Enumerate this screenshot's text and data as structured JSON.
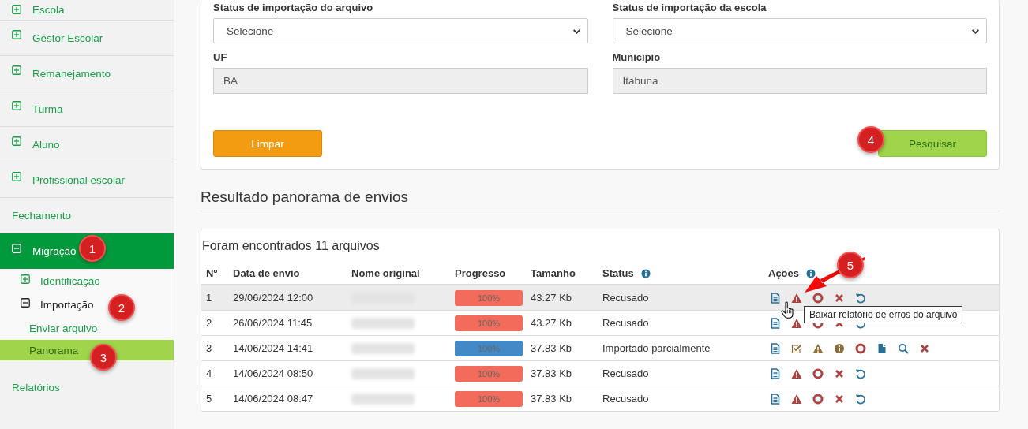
{
  "sidebar": {
    "items": [
      {
        "label": "Escola",
        "kind": "group",
        "expanded": false,
        "selected": false
      },
      {
        "label": "Gestor Escolar",
        "kind": "group",
        "expanded": false,
        "selected": false
      },
      {
        "label": "Remanejamento",
        "kind": "group",
        "expanded": false,
        "selected": false
      },
      {
        "label": "Turma",
        "kind": "group",
        "expanded": false,
        "selected": false
      },
      {
        "label": "Aluno",
        "kind": "group",
        "expanded": false,
        "selected": false
      },
      {
        "label": "Profissional escolar",
        "kind": "group",
        "expanded": false,
        "selected": false
      },
      {
        "label": "Fechamento",
        "kind": "link",
        "selected": false
      },
      {
        "label": "Migração",
        "kind": "group",
        "expanded": true,
        "selected": true,
        "children": [
          {
            "label": "Identificação",
            "kind": "group",
            "expanded": false,
            "selected": false
          },
          {
            "label": "Importação",
            "kind": "group",
            "expanded": true,
            "selected": false,
            "children": [
              {
                "label": "Enviar arquivo",
                "kind": "link",
                "selected": false
              },
              {
                "label": "Panorama",
                "kind": "link",
                "selected": true
              }
            ]
          }
        ]
      },
      {
        "label": "Relatórios",
        "kind": "link",
        "selected": false
      }
    ]
  },
  "filters": {
    "fields": [
      {
        "label": "Status de importação do arquivo",
        "kind": "select",
        "value": "Selecione"
      },
      {
        "label": "Status de importação da escola",
        "kind": "select",
        "value": "Selecione"
      },
      {
        "label": "UF",
        "kind": "readonly",
        "value": "BA"
      },
      {
        "label": "Município",
        "kind": "readonly",
        "value": "Itabuna"
      }
    ],
    "buttons": [
      {
        "label": "Limpar",
        "kind": "clear"
      },
      {
        "label": "Pesquisar",
        "kind": "search"
      }
    ]
  },
  "results": {
    "title": "Resultado panorama de envios",
    "summary": "Foram encontrados 11 arquivos",
    "columns": [
      {
        "label": "Nº"
      },
      {
        "label": "Data de envio"
      },
      {
        "label": "Nome original"
      },
      {
        "label": "Progresso"
      },
      {
        "label": "Tamanho"
      },
      {
        "label": "Status",
        "info": true
      },
      {
        "label": "Ações",
        "info": true
      }
    ],
    "rows": [
      {
        "no": "1",
        "date": "29/06/2024 12:00",
        "progress": {
          "level": 1,
          "label": "100%",
          "color": "#f26b5b"
        },
        "size": "43.27 Kb",
        "status": "Recusado",
        "highlighted": true,
        "actions": [
          {
            "kind": "document",
            "color": "#2b6f94"
          },
          {
            "kind": "warning",
            "color": "#a94442"
          },
          {
            "kind": "stop",
            "color": "#a94442"
          },
          {
            "kind": "remove",
            "color": "#a94442"
          },
          {
            "kind": "undo",
            "color": "#2b6f94"
          }
        ]
      },
      {
        "no": "2",
        "date": "26/06/2024 11:45",
        "progress": {
          "level": 1,
          "label": "100%",
          "color": "#f26b5b"
        },
        "size": "43.27 Kb",
        "status": "Recusado",
        "highlighted": false,
        "actions": [
          {
            "kind": "document",
            "color": "#2b6f94"
          },
          {
            "kind": "warning",
            "color": "#a94442"
          },
          {
            "kind": "stop",
            "color": "#a94442"
          },
          {
            "kind": "remove",
            "color": "#a94442"
          },
          {
            "kind": "undo",
            "color": "#2b6f94"
          }
        ]
      },
      {
        "no": "3",
        "date": "14/06/2024 14:41",
        "progress": {
          "level": 1,
          "label": "100%",
          "color": "#4189c7"
        },
        "size": "37.83 Kb",
        "status": "Importado parcialmente",
        "highlighted": false,
        "actions": [
          {
            "kind": "document",
            "color": "#2b6f94"
          },
          {
            "kind": "checkbox",
            "color": "#8a6d3b"
          },
          {
            "kind": "warning",
            "color": "#8a6d3b"
          },
          {
            "kind": "info",
            "color": "#8a6d3b"
          },
          {
            "kind": "stop",
            "color": "#a94442"
          },
          {
            "kind": "file",
            "color": "#2b6f94"
          },
          {
            "kind": "search",
            "color": "#2b6f94"
          },
          {
            "kind": "remove",
            "color": "#a94442"
          }
        ]
      },
      {
        "no": "4",
        "date": "14/06/2024 08:50",
        "progress": {
          "level": 1,
          "label": "100%",
          "color": "#f26b5b"
        },
        "size": "37.83 Kb",
        "status": "Recusado",
        "highlighted": false,
        "actions": [
          {
            "kind": "document",
            "color": "#2b6f94"
          },
          {
            "kind": "warning",
            "color": "#a94442"
          },
          {
            "kind": "stop",
            "color": "#a94442"
          },
          {
            "kind": "remove",
            "color": "#a94442"
          },
          {
            "kind": "undo",
            "color": "#2b6f94"
          }
        ]
      },
      {
        "no": "5",
        "date": "14/06/2024 08:47",
        "progress": {
          "level": 1,
          "label": "100%",
          "color": "#f26b5b"
        },
        "size": "37.83 Kb",
        "status": "Recusado",
        "highlighted": false,
        "actions": [
          {
            "kind": "document",
            "color": "#2b6f94"
          },
          {
            "kind": "warning",
            "color": "#a94442"
          },
          {
            "kind": "stop",
            "color": "#a94442"
          },
          {
            "kind": "remove",
            "color": "#a94442"
          },
          {
            "kind": "undo",
            "color": "#2b6f94"
          }
        ]
      }
    ]
  },
  "tooltip": "Baixar relatório de erros do arquivo",
  "annotations": [
    {
      "label": "1"
    },
    {
      "label": "2"
    },
    {
      "label": "3"
    },
    {
      "label": "4"
    },
    {
      "label": "5"
    }
  ]
}
